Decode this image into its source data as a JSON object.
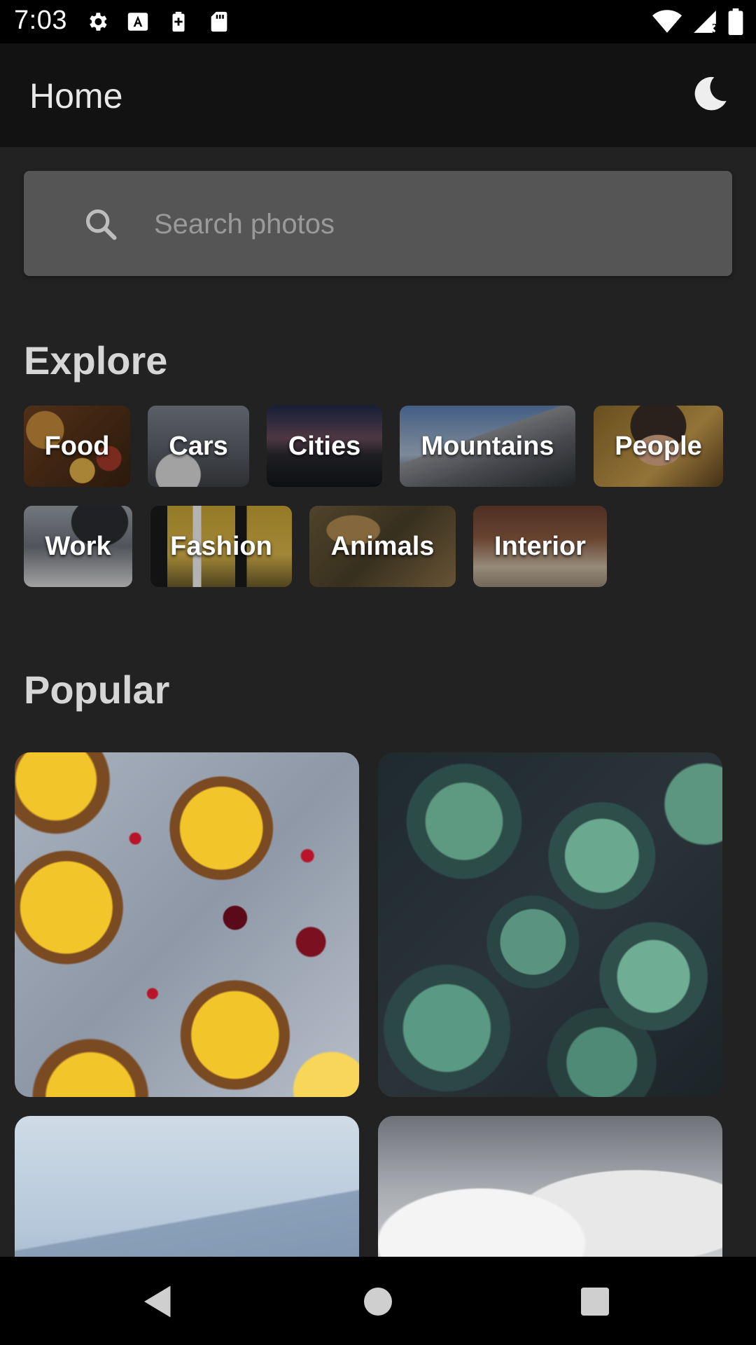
{
  "status_bar": {
    "time": "7:03",
    "left_icons": [
      "settings-icon",
      "font-icon",
      "battery-plus-icon",
      "sd-card-icon"
    ],
    "right_icons": [
      "wifi-icon",
      "no-signal-icon",
      "battery-icon"
    ]
  },
  "app_bar": {
    "title": "Home",
    "theme_icon": "moon-icon"
  },
  "search": {
    "placeholder": "Search photos",
    "value": ""
  },
  "explore": {
    "title": "Explore",
    "categories": [
      {
        "label": "Food"
      },
      {
        "label": "Cars"
      },
      {
        "label": "Cities"
      },
      {
        "label": "Mountains"
      },
      {
        "label": "People"
      },
      {
        "label": "Work"
      },
      {
        "label": "Fashion"
      },
      {
        "label": "Animals"
      },
      {
        "label": "Interior"
      }
    ]
  },
  "popular": {
    "title": "Popular"
  },
  "nav": {
    "buttons": [
      "back-icon",
      "home-icon",
      "recents-icon"
    ]
  },
  "colors": {
    "background": "#222222",
    "app_bar": "#121212",
    "search_box": "#555555",
    "section_title": "#d6d6d6",
    "placeholder": "#9a9a9a"
  }
}
